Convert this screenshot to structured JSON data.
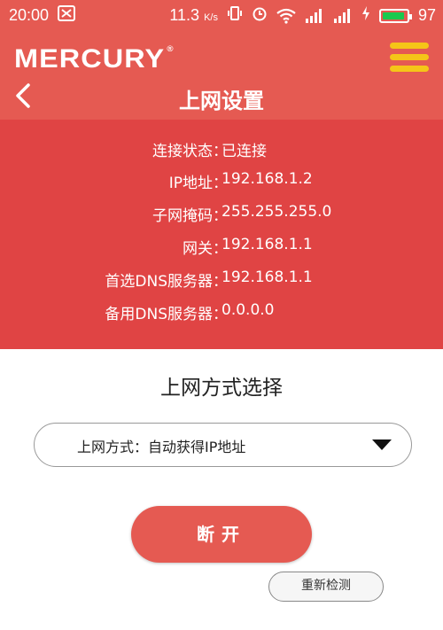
{
  "status_bar": {
    "time": "20:00",
    "net_speed": "11.3",
    "net_unit": "K/s",
    "battery": "97",
    "battery_color": "#19c94e"
  },
  "header": {
    "logo": "MERCURY",
    "logo_mark": "®",
    "title": "上网设置"
  },
  "info": {
    "rows": [
      {
        "key": "连接状态",
        "value": "已连接"
      },
      {
        "key": "IP地址",
        "value": "192.168.1.2"
      },
      {
        "key": "子网掩码",
        "value": "255.255.255.0"
      },
      {
        "key": "网关",
        "value": "192.168.1.1"
      },
      {
        "key": "首选DNS服务器",
        "value": "192.168.1.1"
      },
      {
        "key": "备用DNS服务器",
        "value": "0.0.0.0"
      }
    ],
    "separator": "："
  },
  "method": {
    "title": "上网方式选择",
    "select_label": "上网方式：自动获得IP地址"
  },
  "buttons": {
    "disconnect": "断开",
    "redetect": "重新检测"
  },
  "colors": {
    "header_bg": "#e55a52",
    "panel_bg": "#e04444",
    "menu_icon": "#f5c518"
  }
}
